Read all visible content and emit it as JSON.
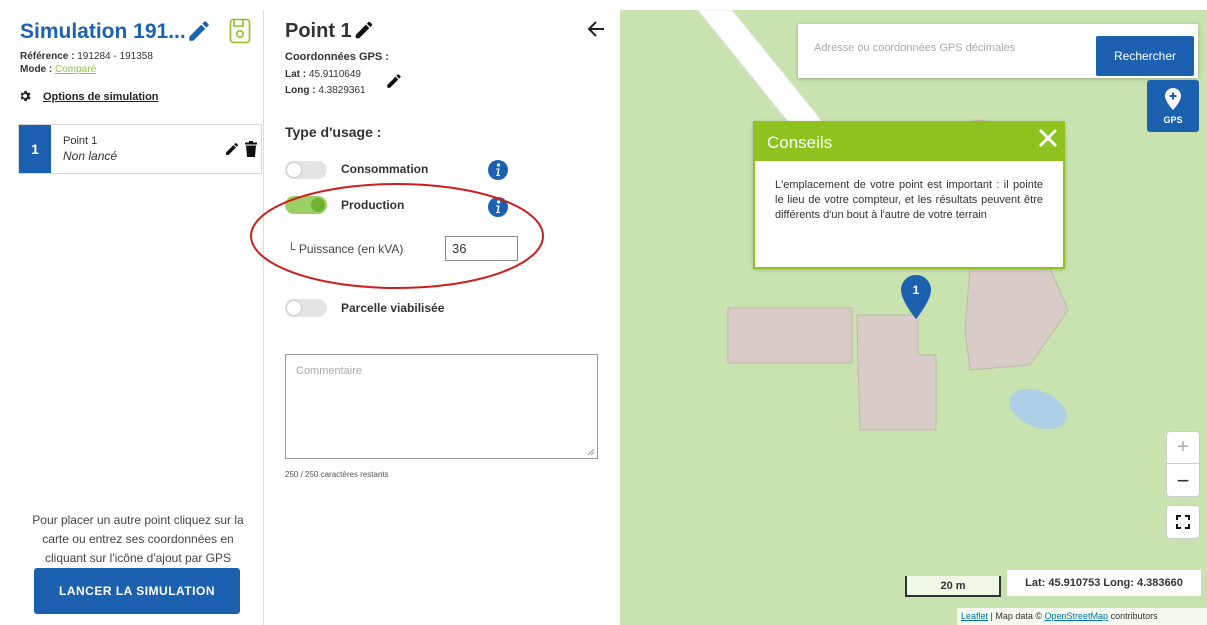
{
  "sidebar": {
    "title": "Simulation 191...",
    "reference_label": "Référence :",
    "reference_value": "191284 - 191358",
    "mode_label": "Mode :",
    "mode_value": "Comparé",
    "options_label": "Options de simulation",
    "points": [
      {
        "number": "1",
        "name": "Point 1",
        "status": "Non lancé"
      }
    ],
    "help_text": "Pour placer un autre point cliquez sur la carte ou entrez ses coordonnées en cliquant sur l'icône d'ajout par GPS",
    "launch_button": "LANCER LA SIMULATION"
  },
  "point_panel": {
    "title": "Point 1",
    "gps_heading": "Coordonnées GPS :",
    "lat_label": "Lat :",
    "lat_value": "45.9110649",
    "long_label": "Long :",
    "long_value": "4.3829361",
    "usage_heading": "Type d'usage :",
    "toggles": [
      {
        "label": "Consommation",
        "on": false
      },
      {
        "label": "Production",
        "on": true
      },
      {
        "label": "Parcelle viabilisée",
        "on": false
      }
    ],
    "puissance_prefix": "└",
    "puissance_label": "Puissance (en kVA)",
    "puissance_value": "36",
    "comment_placeholder": "Commentaire",
    "chars_remaining": "250 / 250 caractères restants"
  },
  "map": {
    "search_placeholder": "Adresse ou coordonnées GPS décimales",
    "search_button": "Rechercher",
    "gps_button_label": "GPS",
    "conseils": {
      "title": "Conseils",
      "body": "L'emplacement de votre point est important : il pointe le lieu de votre compteur, et les résultats peuvent être différents d'un bout à l'autre de votre terrain"
    },
    "marker_label": "1",
    "zoom_in": "+",
    "zoom_out": "−",
    "scale_label": "20 m",
    "coords_readout": "Lat: 45.910753 Long: 4.383660",
    "attribution": {
      "leaflet": "Leaflet",
      "sep": " | Map data © ",
      "osm": "OpenStreetMap",
      "suffix": " contributors"
    }
  },
  "colors": {
    "primary_blue": "#1c61b0",
    "accent_green": "#8dc21f",
    "map_grass": "#c9e3b0",
    "building": "#d8cdc6",
    "highlight_red": "#d01c1c"
  }
}
